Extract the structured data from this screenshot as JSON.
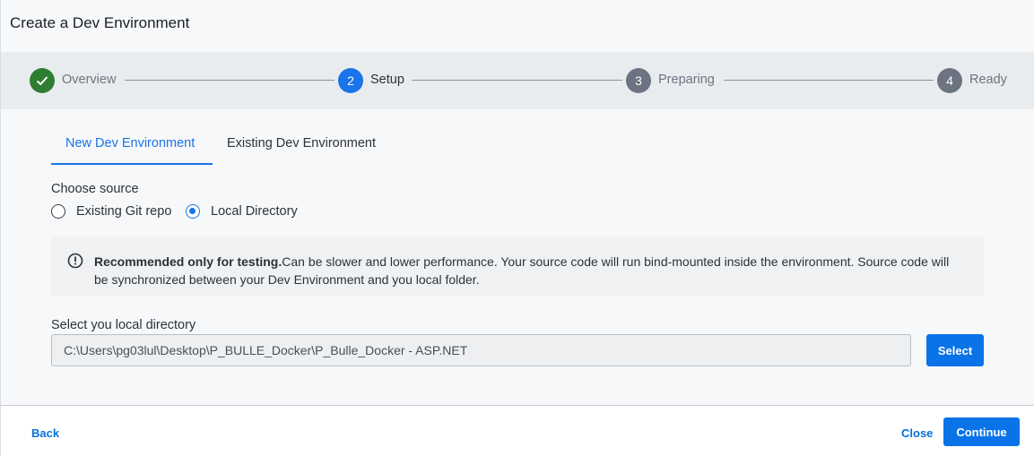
{
  "dialog": {
    "title": "Create a Dev Environment"
  },
  "stepper": {
    "steps": [
      {
        "number": "",
        "label": "Overview",
        "state": "completed"
      },
      {
        "number": "2",
        "label": "Setup",
        "state": "active"
      },
      {
        "number": "3",
        "label": "Preparing",
        "state": "pending"
      },
      {
        "number": "4",
        "label": "Ready",
        "state": "pending"
      }
    ]
  },
  "tabs": [
    {
      "label": "New Dev Environment",
      "selected": true
    },
    {
      "label": "Existing Dev Environment",
      "selected": false
    }
  ],
  "source": {
    "label": "Choose source",
    "options": [
      {
        "label": "Existing Git repo",
        "checked": false
      },
      {
        "label": "Local Directory",
        "checked": true
      }
    ]
  },
  "notice": {
    "bold": "Recommended only for testing.",
    "text": "Can be slower and lower performance. Your source code will run bind-mounted inside the environment. Source code will be synchronized between your Dev Environment and you local folder."
  },
  "directory": {
    "label": "Select you local directory",
    "value": "C:\\Users\\pg03lul\\Desktop\\P_BULLE_Docker\\P_Bulle_Docker - ASP.NET",
    "select_label": "Select"
  },
  "footer": {
    "back_label": "Back",
    "close_label": "Close",
    "continue_label": "Continue"
  },
  "colors": {
    "accent": "#0a73e8",
    "completed": "#2e7d32",
    "pending": "#6b7480"
  }
}
